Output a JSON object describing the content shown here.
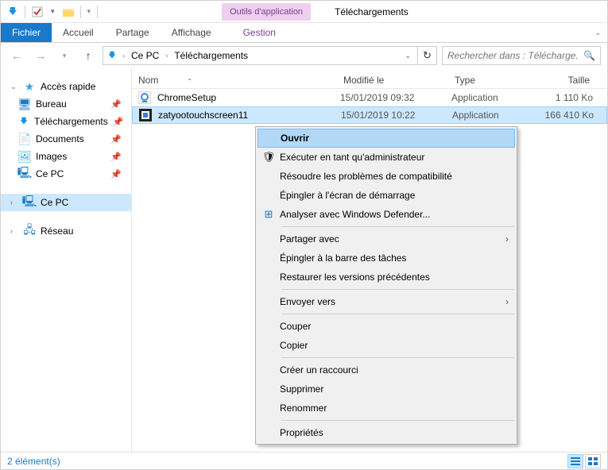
{
  "window": {
    "contextual_tab": "Outils d'application",
    "title": "Téléchargements"
  },
  "ribbon": {
    "file": "Fichier",
    "tabs": [
      "Accueil",
      "Partage",
      "Affichage"
    ],
    "context_tab": "Gestion"
  },
  "breadcrumb": {
    "root": "Ce PC",
    "current": "Téléchargements"
  },
  "search": {
    "placeholder": "Rechercher dans : Télécharge..."
  },
  "columns": {
    "name": "Nom",
    "modified": "Modifié le",
    "type": "Type",
    "size": "Taille"
  },
  "navpane": {
    "quick_access": "Accès rapide",
    "items": [
      {
        "label": "Bureau",
        "pinned": true
      },
      {
        "label": "Téléchargements",
        "pinned": true
      },
      {
        "label": "Documents",
        "pinned": true
      },
      {
        "label": "Images",
        "pinned": true
      },
      {
        "label": "Ce PC",
        "pinned": true
      }
    ],
    "this_pc": "Ce PC",
    "network": "Réseau"
  },
  "files": [
    {
      "name": "ChromeSetup",
      "modified": "15/01/2019 09:32",
      "type": "Application",
      "size": "1 110 Ko"
    },
    {
      "name": "zatyootouchscreen11",
      "modified": "15/01/2019 10:22",
      "type": "Application",
      "size": "166 410 Ko"
    }
  ],
  "context_menu": {
    "open": "Ouvrir",
    "run_admin": "Exécuter en tant qu'administrateur",
    "compat": "Résoudre les problèmes de compatibilité",
    "pin_start": "Épingler à l'écran de démarrage",
    "defender": "Analyser avec Windows Defender...",
    "share_with": "Partager avec",
    "pin_taskbar": "Épingler à la barre des tâches",
    "restore": "Restaurer les versions précédentes",
    "send_to": "Envoyer vers",
    "cut": "Couper",
    "copy": "Copier",
    "shortcut": "Créer un raccourci",
    "delete": "Supprimer",
    "rename": "Renommer",
    "properties": "Propriétés"
  },
  "statusbar": {
    "text": "2 élément(s)"
  }
}
